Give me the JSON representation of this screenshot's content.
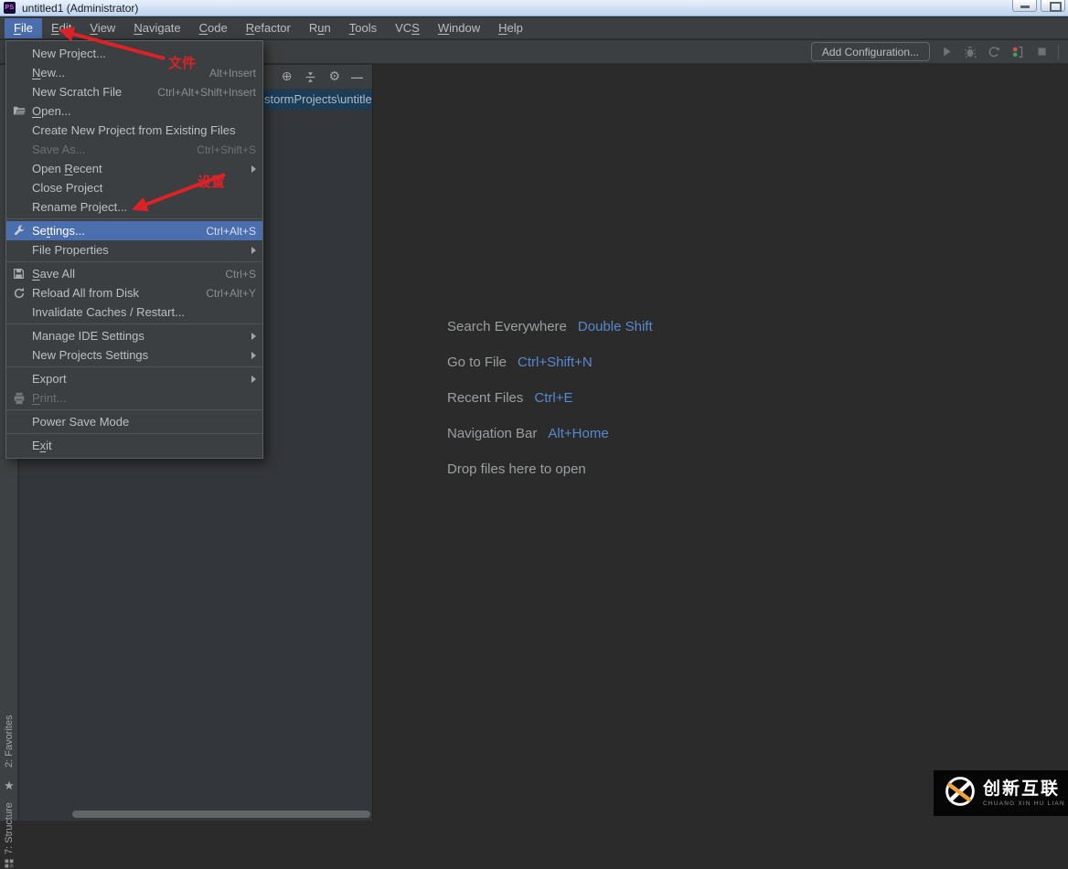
{
  "colors": {
    "accent_blue": "#4b6eaf",
    "shortcut_blue": "#5689cf",
    "annotation_red": "#dc2227",
    "selected_row_blue": "#1d3c55",
    "logo_orange": "#f2a33c",
    "titlebar_blue": "#bdd4ef",
    "dark_ui": "#3c3f41",
    "editor_bg": "#2b2b2b"
  },
  "title_bar": {
    "title": "untitled1 (Administrator)",
    "app_icon_label": "PS"
  },
  "menu_bar": {
    "items": [
      {
        "label": "File",
        "mnemonic": 0,
        "active": true
      },
      {
        "label": "Edit",
        "mnemonic": 0
      },
      {
        "label": "View",
        "mnemonic": 0
      },
      {
        "label": "Navigate",
        "mnemonic": 0
      },
      {
        "label": "Code",
        "mnemonic": 0
      },
      {
        "label": "Refactor",
        "mnemonic": 0
      },
      {
        "label": "Run",
        "mnemonic": 1
      },
      {
        "label": "Tools",
        "mnemonic": 0
      },
      {
        "label": "VCS",
        "mnemonic": 2
      },
      {
        "label": "Window",
        "mnemonic": 0
      },
      {
        "label": "Help",
        "mnemonic": 0
      }
    ]
  },
  "toolbar": {
    "add_configuration_label": "Add Configuration...",
    "icon_names": [
      "run",
      "debug",
      "run-with-coverage",
      "profiler",
      "stop"
    ]
  },
  "file_menu": {
    "items": [
      {
        "type": "item",
        "label": "New Project..."
      },
      {
        "type": "item",
        "label": "New...",
        "mnemonic": 0,
        "shortcut": "Alt+Insert"
      },
      {
        "type": "item",
        "label": "New Scratch File",
        "shortcut": "Ctrl+Alt+Shift+Insert"
      },
      {
        "type": "item",
        "label": "Open...",
        "mnemonic": 0,
        "icon": "folder-open-icon"
      },
      {
        "type": "item",
        "label": "Create New Project from Existing Files"
      },
      {
        "type": "item",
        "label": "Save As...",
        "shortcut": "Ctrl+Shift+S",
        "disabled": true
      },
      {
        "type": "item",
        "label": "Open Recent",
        "mnemonic": 5,
        "submenu": true
      },
      {
        "type": "item",
        "label": "Close Project"
      },
      {
        "type": "item",
        "label": "Rename Project..."
      },
      {
        "type": "separator"
      },
      {
        "type": "item",
        "label": "Settings...",
        "mnemonic": 2,
        "shortcut": "Ctrl+Alt+S",
        "icon": "wrench-icon",
        "selected": true
      },
      {
        "type": "item",
        "label": "File Properties",
        "submenu": true
      },
      {
        "type": "separator"
      },
      {
        "type": "item",
        "label": "Save All",
        "mnemonic": 0,
        "shortcut": "Ctrl+S",
        "icon": "save-icon"
      },
      {
        "type": "item",
        "label": "Reload All from Disk",
        "shortcut": "Ctrl+Alt+Y",
        "icon": "refresh-icon"
      },
      {
        "type": "item",
        "label": "Invalidate Caches / Restart..."
      },
      {
        "type": "separator"
      },
      {
        "type": "item",
        "label": "Manage IDE Settings",
        "submenu": true
      },
      {
        "type": "item",
        "label": "New Projects Settings",
        "submenu": true
      },
      {
        "type": "separator"
      },
      {
        "type": "item",
        "label": "Export",
        "submenu": true
      },
      {
        "type": "item",
        "label": "Print...",
        "mnemonic": 0,
        "icon": "printer-icon",
        "disabled": true
      },
      {
        "type": "separator"
      },
      {
        "type": "item",
        "label": "Power Save Mode"
      },
      {
        "type": "separator"
      },
      {
        "type": "item",
        "label": "Exit",
        "mnemonic": 1
      }
    ]
  },
  "project_panel": {
    "selected_row": "stormProjects\\untitle"
  },
  "editor_area": {
    "hints": [
      {
        "label": "Search Everywhere",
        "shortcut": "Double Shift"
      },
      {
        "label": "Go to File",
        "shortcut": "Ctrl+Shift+N"
      },
      {
        "label": "Recent Files",
        "shortcut": "Ctrl+E"
      },
      {
        "label": "Navigation Bar",
        "shortcut": "Alt+Home"
      },
      {
        "label": "Drop files here to open"
      }
    ]
  },
  "tool_window_bar": {
    "favorites_label": "2: Favorites",
    "structure_label": "7: Structure"
  },
  "annotations": {
    "file_label": "文件",
    "settings_label": "设置"
  },
  "logo": {
    "cn": "创新互联",
    "en": "CHUANG XIN HU LIAN"
  },
  "icons": {
    "locate": "⊕",
    "gear": "⚙",
    "hide": "—",
    "star": "★"
  }
}
